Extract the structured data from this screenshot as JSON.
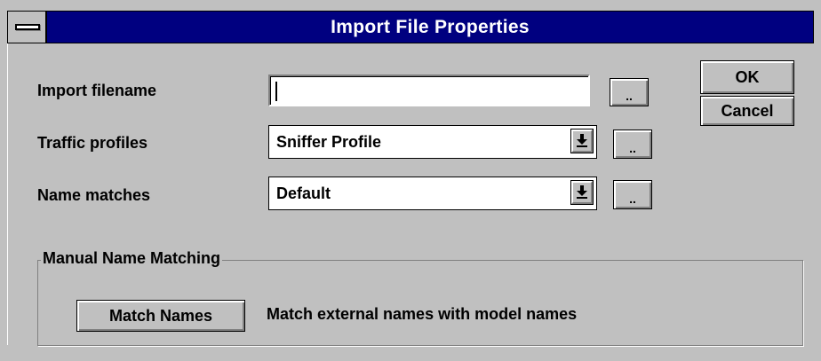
{
  "window": {
    "title": "Import File Properties"
  },
  "form": {
    "import_filename": {
      "label": "Import filename",
      "value": "",
      "browse_label": ".."
    },
    "traffic_profiles": {
      "label": "Traffic profiles",
      "value": "Sniffer Profile",
      "browse_label": ".."
    },
    "name_matches": {
      "label": "Name matches",
      "value": "Default",
      "browse_label": ".."
    }
  },
  "buttons": {
    "ok": "OK",
    "cancel": "Cancel"
  },
  "manual_matching": {
    "group_title": "Manual Name Matching",
    "button_label": "Match Names",
    "description": "Match external names with model names"
  },
  "icons": {
    "system_menu": "system-menu-icon",
    "dropdown_arrow": "dropdown-arrow-icon"
  }
}
